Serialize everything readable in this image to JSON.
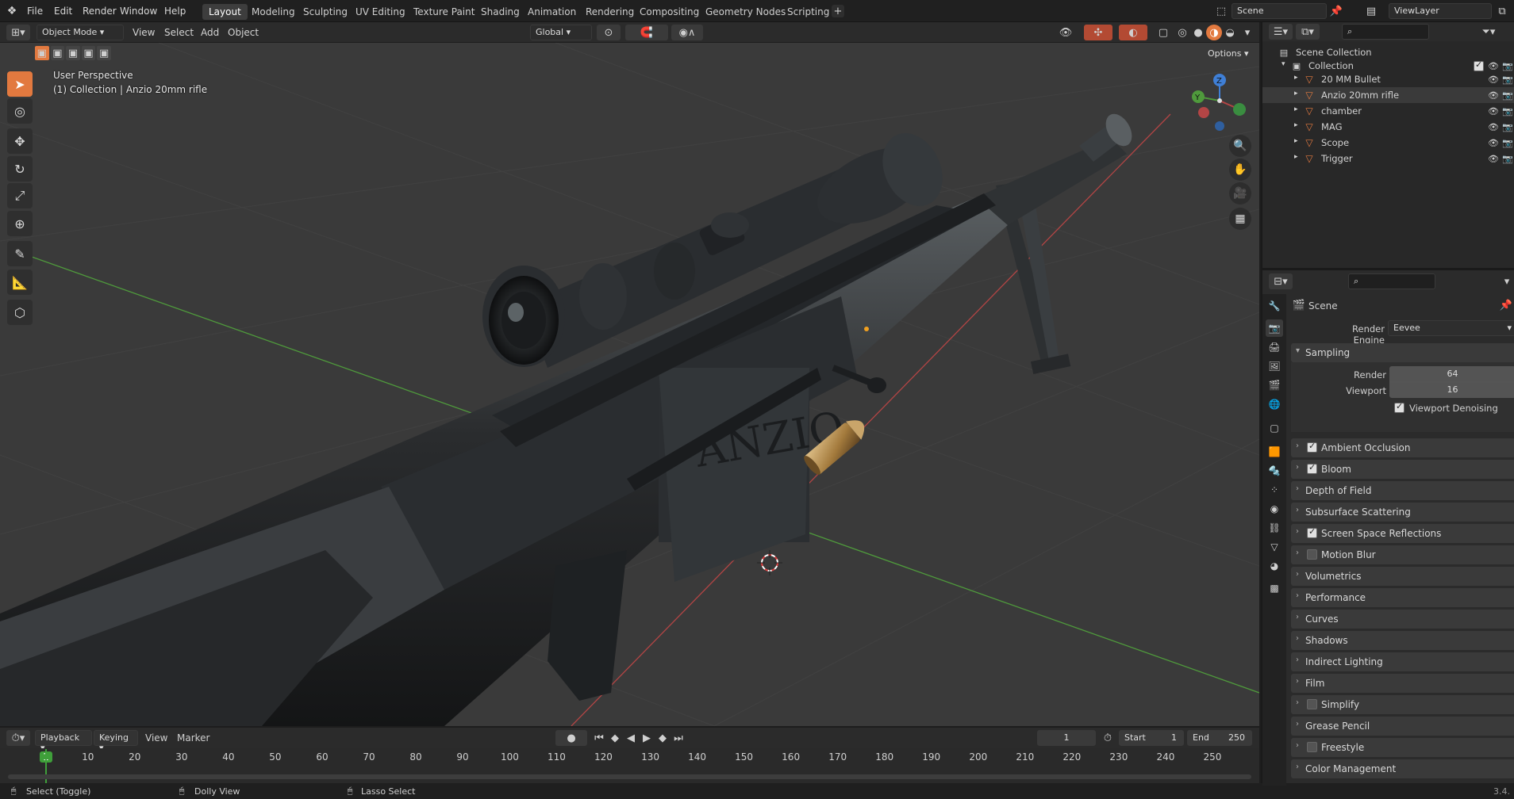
{
  "topbar": {
    "menu": [
      "File",
      "Edit",
      "Render",
      "Window",
      "Help"
    ],
    "workspaces": [
      "Layout",
      "Modeling",
      "Sculpting",
      "UV Editing",
      "Texture Paint",
      "Shading",
      "Animation",
      "Rendering",
      "Compositing",
      "Geometry Nodes",
      "Scripting"
    ],
    "active_workspace": "Layout",
    "scene": "Scene",
    "view_layer": "ViewLayer"
  },
  "viewport_header": {
    "mode": "Object Mode",
    "menus": [
      "View",
      "Select",
      "Add",
      "Object"
    ],
    "orientation": "Global",
    "options": "Options"
  },
  "viewport": {
    "perspective": "User Perspective",
    "context": "(1) Collection | Anzio 20mm rifle",
    "gizmo_axes": [
      "X",
      "Y",
      "Z"
    ],
    "engraving": "ANZIO"
  },
  "outliner": {
    "root": "Scene Collection",
    "collection": "Collection",
    "items": [
      "20 MM Bullet",
      "Anzio 20mm rifle",
      "chamber",
      "MAG",
      "Scope",
      "Trigger"
    ],
    "selected": "Anzio 20mm rifle"
  },
  "properties": {
    "context": "Scene",
    "render_engine_label": "Render Engine",
    "render_engine": "Eevee",
    "sampling": {
      "title": "Sampling",
      "render_label": "Render",
      "render": "64",
      "viewport_label": "Viewport",
      "viewport": "16",
      "denoise": "Viewport Denoising",
      "denoise_on": true
    },
    "panels": [
      {
        "label": "Ambient Occlusion",
        "checkbox": true,
        "on": true
      },
      {
        "label": "Bloom",
        "checkbox": true,
        "on": true
      },
      {
        "label": "Depth of Field",
        "checkbox": false,
        "on": false
      },
      {
        "label": "Subsurface Scattering",
        "checkbox": false,
        "on": false
      },
      {
        "label": "Screen Space Reflections",
        "checkbox": true,
        "on": true
      },
      {
        "label": "Motion Blur",
        "checkbox": true,
        "on": false
      },
      {
        "label": "Volumetrics",
        "checkbox": false,
        "on": false
      },
      {
        "label": "Performance",
        "checkbox": false,
        "on": false
      },
      {
        "label": "Curves",
        "checkbox": false,
        "on": false
      },
      {
        "label": "Shadows",
        "checkbox": false,
        "on": false
      },
      {
        "label": "Indirect Lighting",
        "checkbox": false,
        "on": false
      },
      {
        "label": "Film",
        "checkbox": false,
        "on": false
      },
      {
        "label": "Simplify",
        "checkbox": true,
        "on": false
      },
      {
        "label": "Grease Pencil",
        "checkbox": false,
        "on": false
      },
      {
        "label": "Freestyle",
        "checkbox": true,
        "on": false
      },
      {
        "label": "Color Management",
        "checkbox": false,
        "on": false
      }
    ]
  },
  "timeline": {
    "menus": [
      "Playback",
      "Keying",
      "View",
      "Marker"
    ],
    "current_frame": "1",
    "start_label": "Start",
    "start": "1",
    "end_label": "End",
    "end": "250",
    "ticks": [
      "1",
      "10",
      "20",
      "30",
      "40",
      "50",
      "60",
      "70",
      "80",
      "90",
      "100",
      "110",
      "120",
      "130",
      "140",
      "150",
      "160",
      "170",
      "180",
      "190",
      "200",
      "210",
      "220",
      "230",
      "240",
      "250"
    ]
  },
  "statusbar": {
    "left": "Select (Toggle)",
    "middle": "Dolly View",
    "right": "Lasso Select",
    "version": "3.4."
  },
  "colors": {
    "accent": "#e2793f",
    "selected_frame": "#3f9f3a",
    "x_axis": "#b34545",
    "y_axis": "#4f9a3c",
    "z_axis": "#3f7fd6"
  }
}
